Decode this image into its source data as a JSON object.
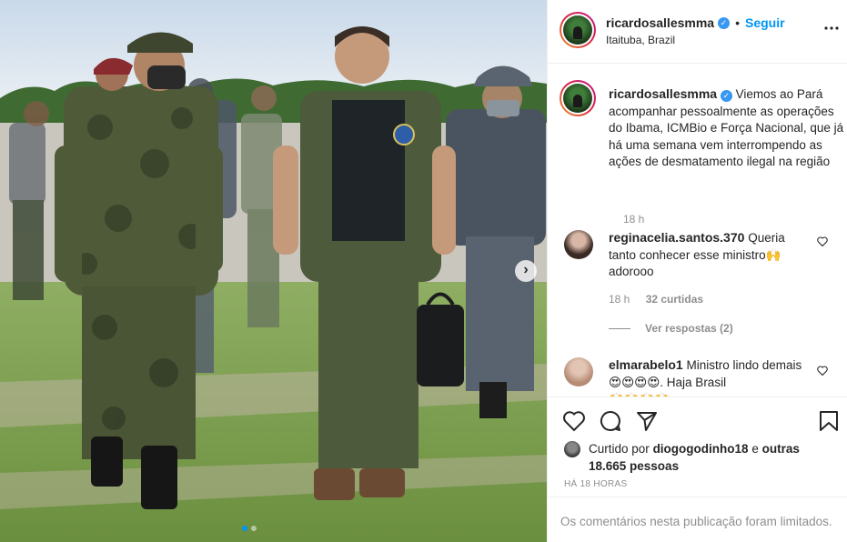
{
  "post": {
    "username": "ricardosallesmma",
    "separator": "•",
    "follow_label": "Seguir",
    "location": "Itaituba, Brazil",
    "more_icon": "more-horizontal-icon",
    "verified_glyph": "✓"
  },
  "caption": {
    "username": "ricardosallesmma",
    "text": "Viemos ao Pará acompanhar pessoalmente as operações do Ibama, ICMBio e Força Nacional, que já há uma semana vem interrompendo as ações de desmatamento ilegal na região",
    "time": "18 h"
  },
  "comments": [
    {
      "username": "reginacelia.santos.370",
      "text": "Queria tanto conhecer esse ministro🙌 adorooo",
      "time": "18 h",
      "likes": "32 curtidas",
      "replies_label": "Ver respostas (2)"
    },
    {
      "username": "elmarabelo1",
      "text": "Ministro lindo demais😍😍😍😍. Haja Brasil",
      "partial": "🙌🙌🙌🙌"
    }
  ],
  "actions": {
    "like_icon": "heart-icon",
    "comment_icon": "comment-icon",
    "share_icon": "paper-plane-icon",
    "save_icon": "bookmark-icon"
  },
  "likes": {
    "prefix": "Curtido por",
    "user": "diogogodinho18",
    "connector": "e",
    "others": "outras 18.665 pessoas"
  },
  "time_ago": "HÁ 18 HORAS",
  "limited_comments": "Os comentários nesta publicação foram limitados.",
  "carousel": {
    "next_glyph": "›",
    "active_slide": 1,
    "slides": 2
  },
  "colors": {
    "link_blue": "#0095f6",
    "verified_blue": "#3897f0",
    "muted": "#8e8e8e",
    "text": "#262626"
  }
}
